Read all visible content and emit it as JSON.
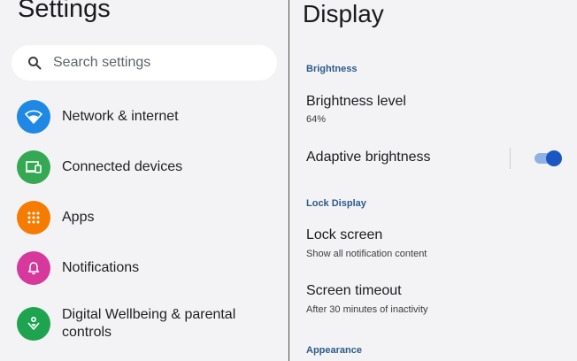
{
  "left": {
    "title": "Settings",
    "search": {
      "placeholder": "Search settings",
      "icon": "search-icon"
    },
    "items": [
      {
        "label": "Network & internet",
        "icon": "wifi-icon",
        "color": "#1f88e5"
      },
      {
        "label": "Connected devices",
        "icon": "devices-icon",
        "color": "#34a853"
      },
      {
        "label": "Apps",
        "icon": "apps-grid-icon",
        "color": "#f57c00"
      },
      {
        "label": "Notifications",
        "icon": "bell-icon",
        "color": "#d6399b"
      },
      {
        "label": "Digital Wellbeing & parental controls",
        "icon": "wellbeing-icon",
        "color": "#1ea44f"
      }
    ]
  },
  "right": {
    "title": "Display",
    "sections": {
      "brightness": "Brightness",
      "lock_display": "Lock Display",
      "appearance": "Appearance"
    },
    "prefs": {
      "brightness_level": {
        "title": "Brightness level",
        "summary": "64%"
      },
      "adaptive_brightness": {
        "title": "Adaptive brightness",
        "enabled": true
      },
      "lock_screen": {
        "title": "Lock screen",
        "summary": "Show all notification content"
      },
      "screen_timeout": {
        "title": "Screen timeout",
        "summary": "After 30 minutes of inactivity"
      }
    },
    "accent_color": "#1a57c2"
  }
}
